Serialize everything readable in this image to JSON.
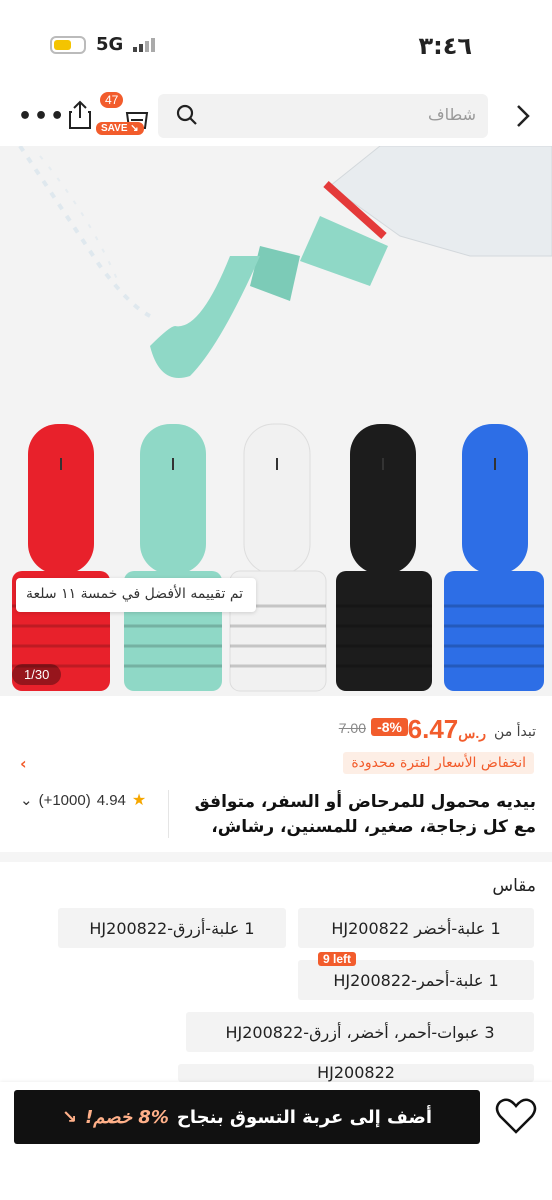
{
  "status": {
    "time": "٣:٤٦",
    "network": "5G"
  },
  "header": {
    "search_placeholder": "شطاف",
    "cart_count": "47",
    "save_label": "SAVE"
  },
  "gallery": {
    "counter": "1/30",
    "promo_tip": "تم تقييمه الأفضل في خمسة ١١ سلعة"
  },
  "price": {
    "from_label": "تبدأ من",
    "value": "6.47",
    "currency": "ر.س",
    "discount": "-8%",
    "old_price": "7.00"
  },
  "deal": {
    "label": "انخفاض الأسعار لفترة محدودة"
  },
  "product": {
    "title": "بيديه محمول للمرحاض أو السفر، متوافق مع كل زجاجة، صغير، للمسنين، رشاش، حيوي",
    "rating": "4.94",
    "reviews": "(+1000)"
  },
  "sizes": {
    "label": "مقاس",
    "options": [
      "1 علبة-أخضر HJ200822",
      "1 علبة-أزرق-HJ200822",
      "1 علبة-أحمر-HJ200822",
      "3 عبوات-أحمر، أخضر، أزرق-HJ200822",
      "HJ200822"
    ],
    "left_badge": "9 left"
  },
  "bottom": {
    "discount_text": "8% خصم!",
    "add_to_cart": "أضف إلى عربة التسوق بنجاح"
  },
  "colors": {
    "accent": "#f25c2c",
    "red": "#e8212b",
    "mint": "#8fd8c6",
    "white": "#f1f1f1",
    "black": "#1c1c1c",
    "blue": "#2d6ee6"
  }
}
